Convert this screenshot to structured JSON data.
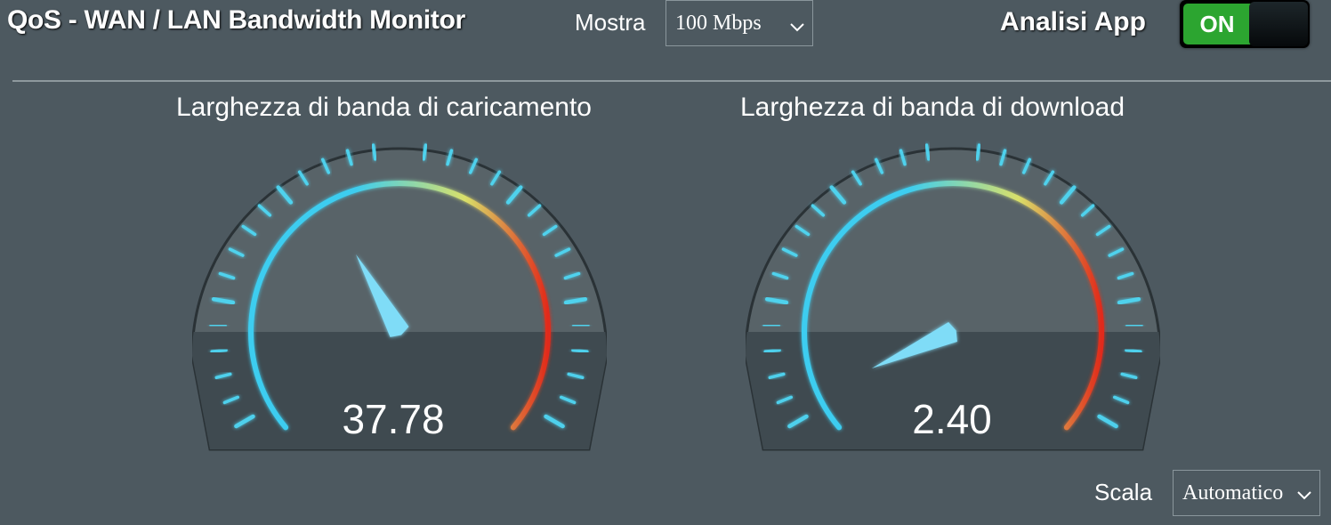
{
  "header": {
    "title": "QoS - WAN / LAN Bandwidth Monitor",
    "mostra_label": "Mostra",
    "mostra_value": "100 Mbps",
    "app_analysis_label": "Analisi App",
    "toggle_label": "ON"
  },
  "gauges": [
    {
      "title": "Larghezza di banda di caricamento",
      "value": "37.78",
      "max": 100
    },
    {
      "title": "Larghezza di banda di download",
      "value": "2.40",
      "max": 100
    }
  ],
  "footer": {
    "scale_label": "Scala",
    "scale_value": "Automatico"
  },
  "colors": {
    "background": "#4d5960",
    "tick": "#4fd8f5",
    "arc_start": "#3ccdf0",
    "arc_mid": "#d9e06a",
    "arc_end": "#e12a1a",
    "toggle_on": "#2ca530"
  }
}
